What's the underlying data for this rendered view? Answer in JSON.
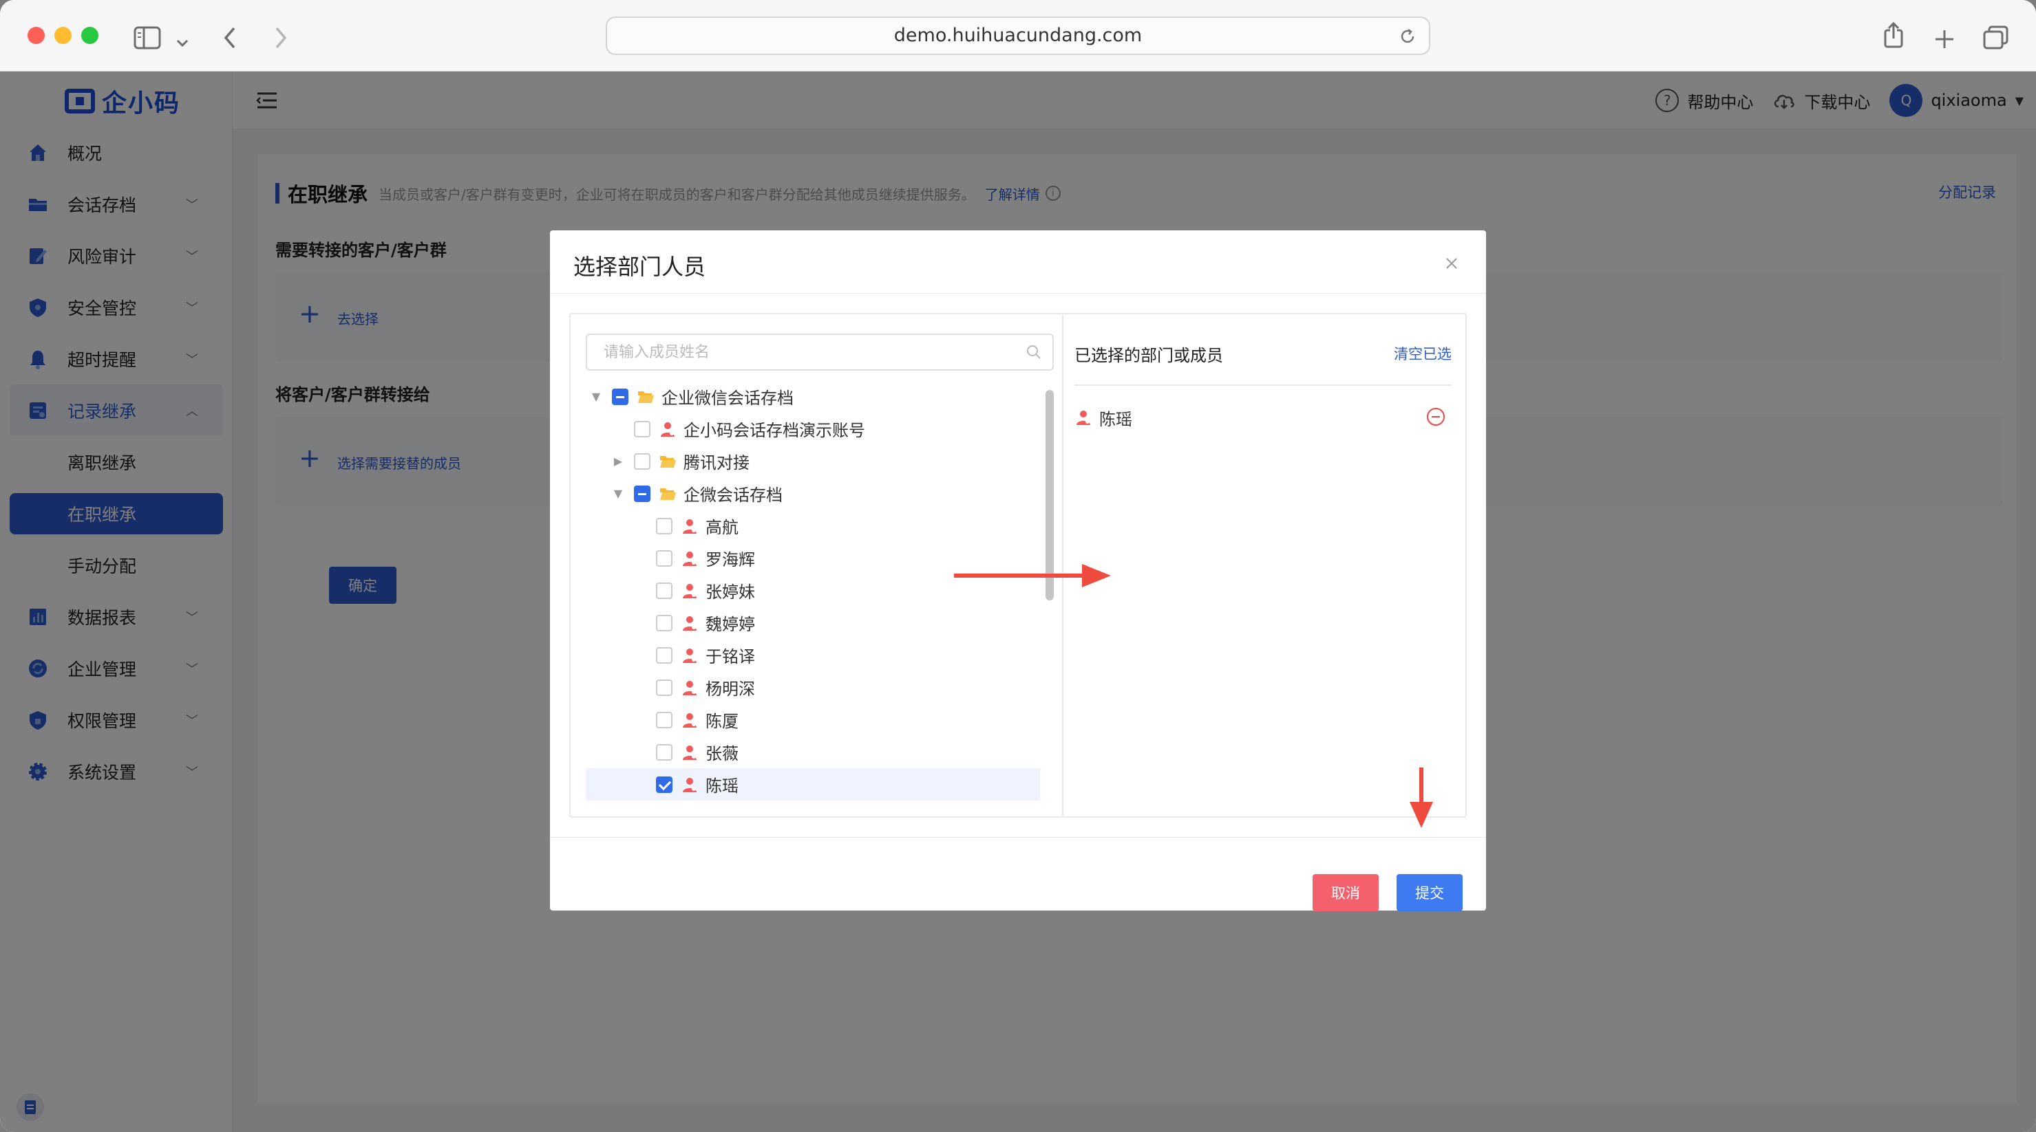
{
  "browser": {
    "url": "demo.huihuacundang.com"
  },
  "app": {
    "logo": "企小码",
    "sidebar": {
      "items": [
        {
          "label": "概况",
          "icon": "home-icon"
        },
        {
          "label": "会话存档",
          "icon": "folder-icon"
        },
        {
          "label": "风险审计",
          "icon": "edit-icon"
        },
        {
          "label": "安全管控",
          "icon": "shield-icon"
        },
        {
          "label": "超时提醒",
          "icon": "bell-icon"
        },
        {
          "label": "记录继承",
          "icon": "record-icon"
        },
        {
          "label": "数据报表",
          "icon": "chart-icon"
        },
        {
          "label": "企业管理",
          "icon": "sync-icon"
        },
        {
          "label": "权限管理",
          "icon": "lock-shield-icon"
        },
        {
          "label": "系统设置",
          "icon": "gear-icon"
        }
      ],
      "sub_items": [
        {
          "label": "离职继承"
        },
        {
          "label": "在职继承"
        },
        {
          "label": "手动分配"
        }
      ]
    },
    "topbar": {
      "help": "帮助中心",
      "download": "下载中心",
      "avatar_letter": "Q",
      "username": "qixiaoma"
    },
    "page": {
      "title": "在职继承",
      "description": "当成员或客户/客户群有变更时，企业可将在职成员的客户和客户群分配给其他成员继续提供服务。",
      "learn_more": "了解详情",
      "record_link": "分配记录",
      "section1_label": "需要转接的客户/客户群",
      "section1_action": "去选择",
      "section2_label": "将客户/客户群转接给",
      "section2_action": "选择需要接替的成员",
      "confirm_button": "确定"
    }
  },
  "modal": {
    "title": "选择部门人员",
    "search_placeholder": "请输入成员姓名",
    "tree": [
      {
        "label": "企业微信会话存档",
        "type": "folder",
        "level": 0,
        "caret": "down",
        "check": "partial"
      },
      {
        "label": "企小码会话存档演示账号",
        "type": "person",
        "level": 1,
        "caret": "none",
        "check": "none"
      },
      {
        "label": "腾讯对接",
        "type": "folder",
        "level": 1,
        "caret": "right",
        "check": "none"
      },
      {
        "label": "企微会话存档",
        "type": "folder",
        "level": 1,
        "caret": "down",
        "check": "partial"
      },
      {
        "label": "高航",
        "type": "person",
        "level": 2,
        "caret": "none",
        "check": "none"
      },
      {
        "label": "罗海辉",
        "type": "person",
        "level": 2,
        "caret": "none",
        "check": "none"
      },
      {
        "label": "张婷妹",
        "type": "person",
        "level": 2,
        "caret": "none",
        "check": "none"
      },
      {
        "label": "魏婷婷",
        "type": "person",
        "level": 2,
        "caret": "none",
        "check": "none"
      },
      {
        "label": "于铭译",
        "type": "person",
        "level": 2,
        "caret": "none",
        "check": "none"
      },
      {
        "label": "杨明深",
        "type": "person",
        "level": 2,
        "caret": "none",
        "check": "none"
      },
      {
        "label": "陈厦",
        "type": "person",
        "level": 2,
        "caret": "none",
        "check": "none"
      },
      {
        "label": "张薇",
        "type": "person",
        "level": 2,
        "caret": "none",
        "check": "none"
      },
      {
        "label": "陈瑶",
        "type": "person",
        "level": 2,
        "caret": "none",
        "check": "checked"
      }
    ],
    "selected_title": "已选择的部门或成员",
    "clear_all": "清空已选",
    "selected": [
      {
        "label": "陈瑶"
      }
    ],
    "cancel_label": "取消",
    "submit_label": "提交"
  },
  "colors": {
    "primary": "#2f5bd0",
    "checkbox": "#2f6be8",
    "cancel": "#f4606c",
    "submit": "#3f7bf0",
    "annotation_arrow": "#ee4b3e",
    "folder": "#f5b82e",
    "person": "#f05a5a"
  }
}
